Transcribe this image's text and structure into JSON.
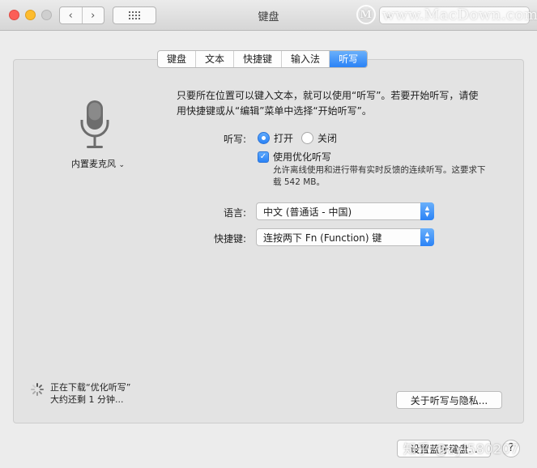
{
  "window": {
    "title": "键盘",
    "search": {
      "value": "",
      "placeholder": ""
    },
    "watermark_top": "www.MacDown.com",
    "watermark_bottom": "知乎 @zyl580207"
  },
  "tabs": [
    {
      "label": "键盘",
      "active": false
    },
    {
      "label": "文本",
      "active": false
    },
    {
      "label": "快捷键",
      "active": false
    },
    {
      "label": "输入法",
      "active": false
    },
    {
      "label": "听写",
      "active": true
    }
  ],
  "mic": {
    "label": "内置麦克风",
    "icon": "microphone-icon"
  },
  "intro": "只要所在位置可以键入文本，就可以使用“听写”。若要开始听写，请使用快捷键或从“编辑”菜单中选择“开始听写”。",
  "dictation": {
    "label": "听写:",
    "on_label": "打开",
    "off_label": "关闭",
    "selected": "打开"
  },
  "enhanced": {
    "label": "使用优化听写",
    "checked": true,
    "description": "允许离线使用和进行带有实时反馈的连续听写。这要求下载 542 MB。"
  },
  "language": {
    "label": "语言:",
    "value": "中文 (普通话 - 中国)"
  },
  "shortcut": {
    "label": "快捷键:",
    "value": "连按两下 Fn (Function) 键"
  },
  "download": {
    "line1": "正在下载“优化听写”",
    "line2": "大约还剩 1 分钟..."
  },
  "buttons": {
    "privacy": "关于听写与隐私...",
    "bluetooth": "设置蓝牙键盘...",
    "help": "?"
  },
  "colors": {
    "accent": "#2a82f6",
    "panel": "#e3e3e3"
  }
}
